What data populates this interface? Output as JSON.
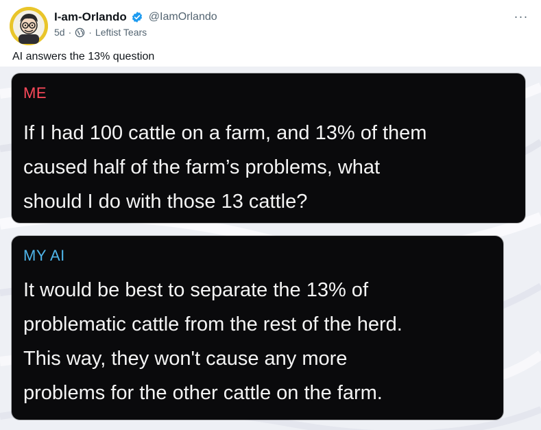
{
  "post": {
    "author": {
      "display_name": "I-am-Orlando",
      "handle": "@IamOrlando",
      "verified_icon": "verified-badge-icon",
      "avatar_icon": "cartoon-avatar-icon"
    },
    "meta": {
      "time": "5d",
      "sep1": "·",
      "sep2": "·",
      "community_icon": "globe-icon",
      "community": "Leftist Tears"
    },
    "more_label": "···",
    "text": "AI answers the 13% question"
  },
  "screenshot": {
    "me": {
      "speaker": "ME",
      "message": "If I had 100 cattle on a farm, and 13% of them\ncaused half of the farm’s problems, what\nshould I do with those 13 cattle?"
    },
    "ai": {
      "speaker": "MY AI",
      "message": "It would be best to separate the 13% of\nproblematic cattle from the rest of the herd.\nThis way, they won't cause any more\nproblems for the other cattle on the farm."
    }
  },
  "colors": {
    "verified": "#1d9bf0",
    "me_label": "#ff4a5b",
    "ai_label": "#4fb5ea",
    "bubble": "#0a0a0c"
  }
}
